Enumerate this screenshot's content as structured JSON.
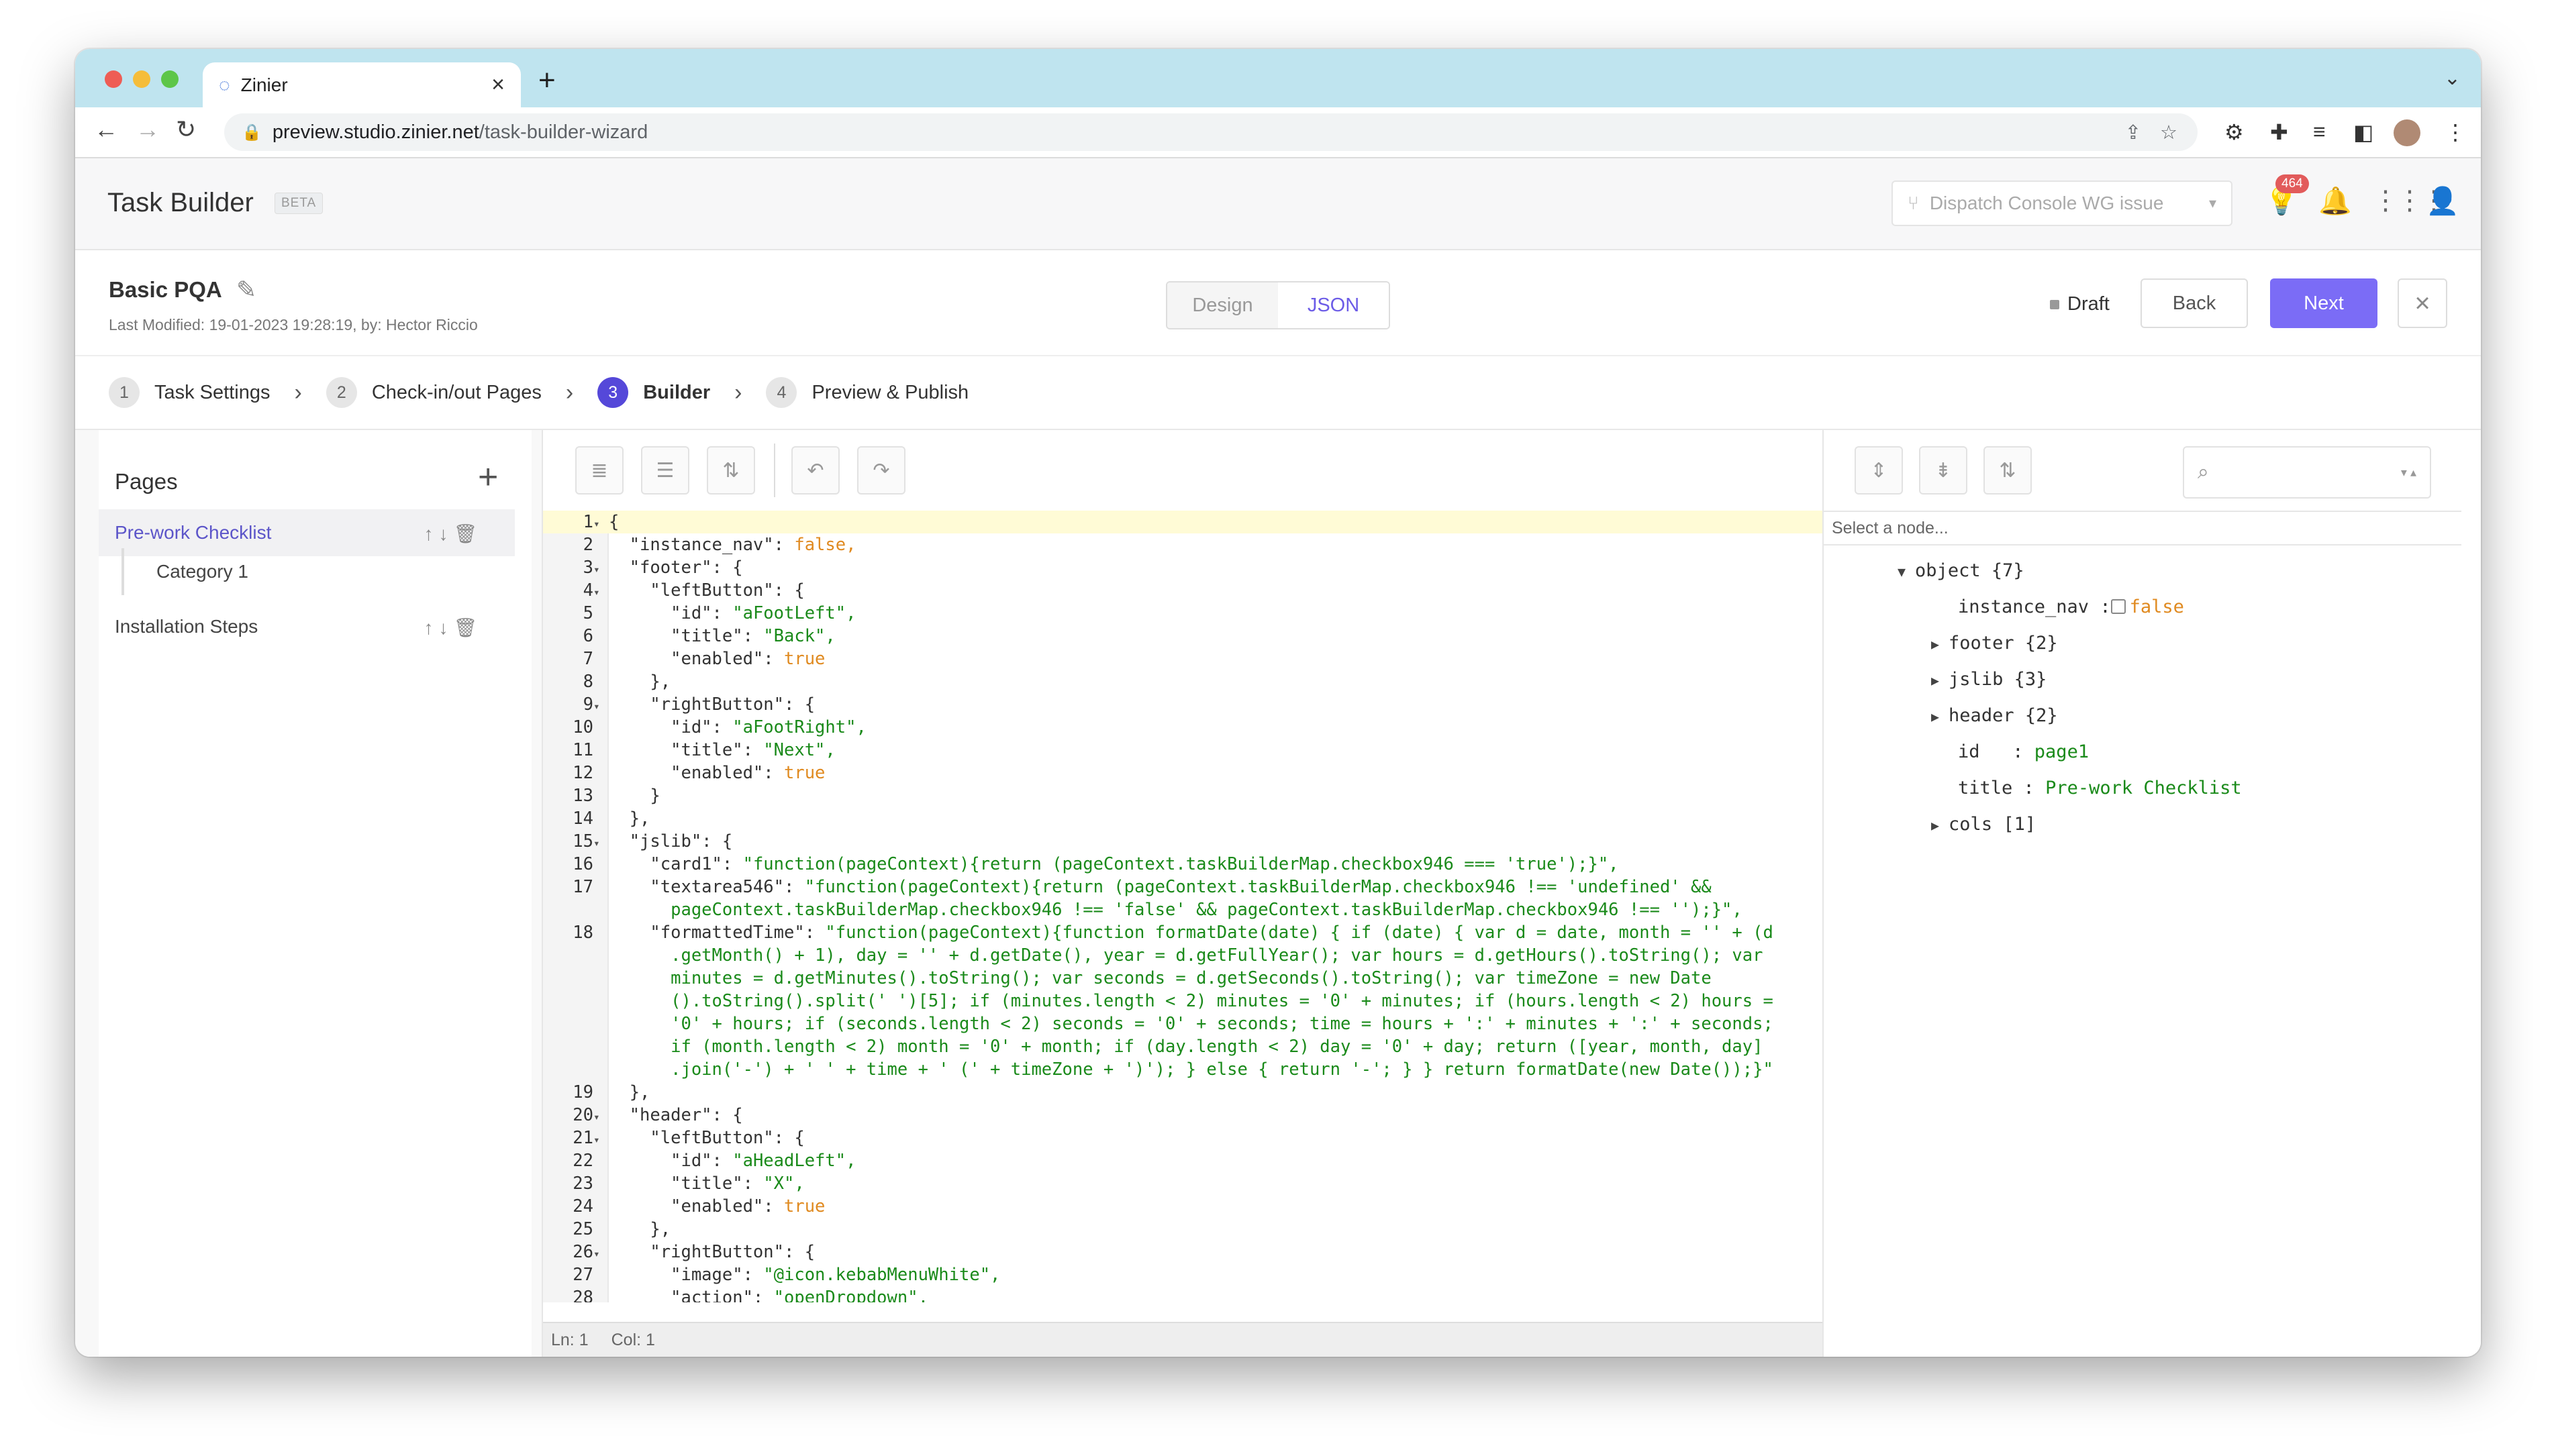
{
  "browser": {
    "tab_title": "Zinier",
    "url_host": "preview.studio.zinier.net",
    "url_path": "/task-builder-wizard"
  },
  "app": {
    "title": "Task Builder",
    "beta": "BETA",
    "dispatch_select": "Dispatch Console WG issue",
    "notification_count": "464"
  },
  "form": {
    "name": "Basic PQA",
    "modified": "Last Modified: 19-01-2023 19:28:19, by: Hector Riccio",
    "mode_design": "Design",
    "mode_json": "JSON",
    "status": "Draft",
    "back": "Back",
    "next": "Next"
  },
  "steps": [
    {
      "num": "1",
      "label": "Task Settings"
    },
    {
      "num": "2",
      "label": "Check-in/out Pages"
    },
    {
      "num": "3",
      "label": "Builder"
    },
    {
      "num": "4",
      "label": "Preview & Publish"
    }
  ],
  "pages": {
    "title": "Pages",
    "items": [
      "Pre-work Checklist",
      "Installation Steps"
    ],
    "sub_item": "Category 1"
  },
  "editor": {
    "lines": [
      {
        "n": "1",
        "f": "▾",
        "t": "{"
      },
      {
        "n": "2",
        "f": "",
        "t": "  \"instance_nav\": false,"
      },
      {
        "n": "3",
        "f": "▾",
        "t": "  \"footer\": {"
      },
      {
        "n": "4",
        "f": "▾",
        "t": "    \"leftButton\": {"
      },
      {
        "n": "5",
        "f": "",
        "t": "      \"id\": \"aFootLeft\","
      },
      {
        "n": "6",
        "f": "",
        "t": "      \"title\": \"Back\","
      },
      {
        "n": "7",
        "f": "",
        "t": "      \"enabled\": true"
      },
      {
        "n": "8",
        "f": "",
        "t": "    },"
      },
      {
        "n": "9",
        "f": "▾",
        "t": "    \"rightButton\": {"
      },
      {
        "n": "10",
        "f": "",
        "t": "      \"id\": \"aFootRight\","
      },
      {
        "n": "11",
        "f": "",
        "t": "      \"title\": \"Next\","
      },
      {
        "n": "12",
        "f": "",
        "t": "      \"enabled\": true"
      },
      {
        "n": "13",
        "f": "",
        "t": "    }"
      },
      {
        "n": "14",
        "f": "",
        "t": "  },"
      },
      {
        "n": "15",
        "f": "▾",
        "t": "  \"jslib\": {"
      },
      {
        "n": "16",
        "f": "",
        "t": "    \"card1\": \"function(pageContext){return (pageContext.taskBuilderMap.checkbox946 === 'true');}\","
      },
      {
        "n": "17",
        "f": "",
        "t": "    \"textarea546\": \"function(pageContext){return (pageContext.taskBuilderMap.checkbox946 !== 'undefined' &&"
      },
      {
        "n": "",
        "f": "",
        "t": "      pageContext.taskBuilderMap.checkbox946 !== 'false' && pageContext.taskBuilderMap.checkbox946 !== '');}\","
      },
      {
        "n": "18",
        "f": "",
        "t": "    \"formattedTime\": \"function(pageContext){function formatDate(date) { if (date) { var d = date, month = '' + (d"
      },
      {
        "n": "",
        "f": "",
        "t": "      .getMonth() + 1), day = '' + d.getDate(), year = d.getFullYear(); var hours = d.getHours().toString(); var"
      },
      {
        "n": "",
        "f": "",
        "t": "      minutes = d.getMinutes().toString(); var seconds = d.getSeconds().toString(); var timeZone = new Date"
      },
      {
        "n": "",
        "f": "",
        "t": "      ().toString().split(' ')[5]; if (minutes.length < 2) minutes = '0' + minutes; if (hours.length < 2) hours ="
      },
      {
        "n": "",
        "f": "",
        "t": "      '0' + hours; if (seconds.length < 2) seconds = '0' + seconds; time = hours + ':' + minutes + ':' + seconds;"
      },
      {
        "n": "",
        "f": "",
        "t": "      if (month.length < 2) month = '0' + month; if (day.length < 2) day = '0' + day; return ([year, month, day]"
      },
      {
        "n": "",
        "f": "",
        "t": "      .join('-') + ' ' + time + ' (' + timeZone + ')'); } else { return '-'; } } return formatDate(new Date());}\""
      },
      {
        "n": "19",
        "f": "",
        "t": "  },"
      },
      {
        "n": "20",
        "f": "▾",
        "t": "  \"header\": {"
      },
      {
        "n": "21",
        "f": "▾",
        "t": "    \"leftButton\": {"
      },
      {
        "n": "22",
        "f": "",
        "t": "      \"id\": \"aHeadLeft\","
      },
      {
        "n": "23",
        "f": "",
        "t": "      \"title\": \"X\","
      },
      {
        "n": "24",
        "f": "",
        "t": "      \"enabled\": true"
      },
      {
        "n": "25",
        "f": "",
        "t": "    },"
      },
      {
        "n": "26",
        "f": "▾",
        "t": "    \"rightButton\": {"
      },
      {
        "n": "27",
        "f": "",
        "t": "      \"image\": \"@icon.kebabMenuWhite\","
      },
      {
        "n": "28",
        "f": "",
        "t": "      \"action\": \"openDropdown\","
      }
    ],
    "status_ln": "Ln: 1",
    "status_col": "Col: 1"
  },
  "tree": {
    "select_placeholder": "Select a node...",
    "root": "object {7}",
    "instance_nav_key": "instance_nav",
    "instance_nav_val": "false",
    "footer": "footer {2}",
    "jslib": "jslib {3}",
    "header": "header {2}",
    "id_key": "id",
    "id_val": "page1",
    "title_key": "title",
    "title_val": "Pre-work Checklist",
    "cols": "cols [1]"
  },
  "colors": {
    "accent": "#7b6cf6",
    "step_active": "#5548d9",
    "string": "#1a8a1a",
    "boolean": "#e08a20"
  }
}
